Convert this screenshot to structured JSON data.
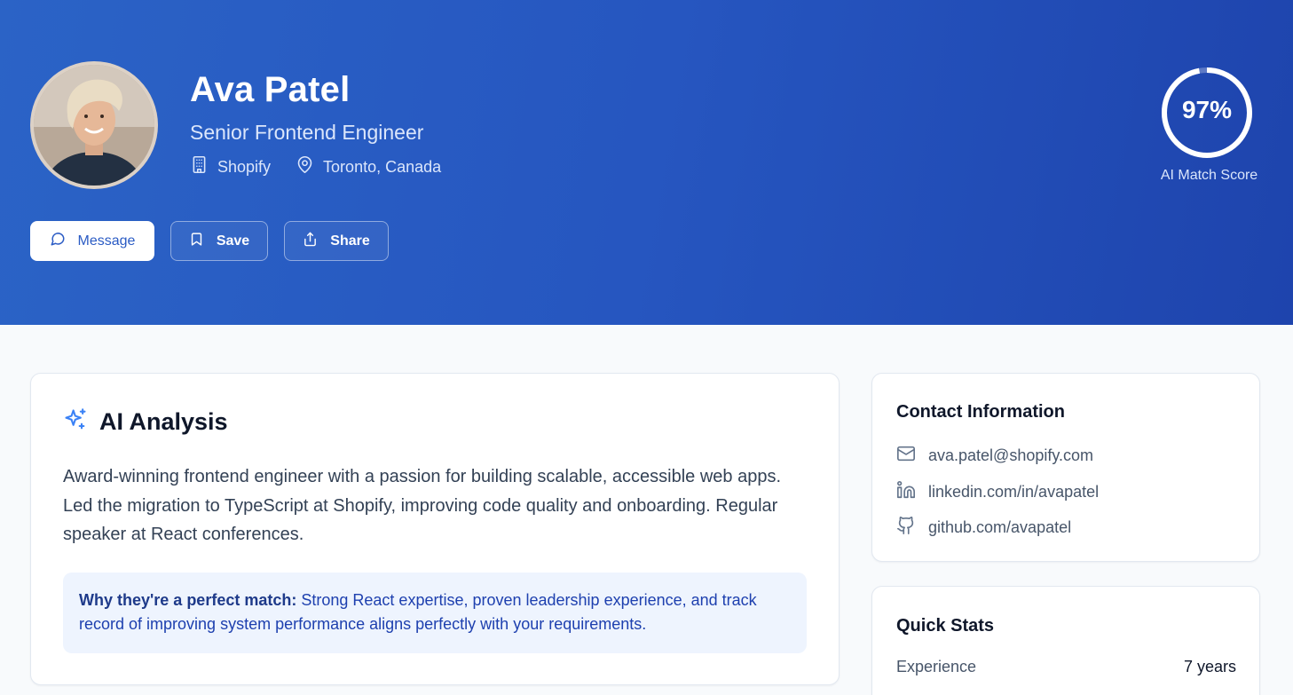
{
  "profile": {
    "name": "Ava Patel",
    "title": "Senior Frontend Engineer",
    "company": "Shopify",
    "location": "Toronto, Canada"
  },
  "actions": {
    "message": "Message",
    "save": "Save",
    "share": "Share"
  },
  "match_score": {
    "value": "97%",
    "fraction": 0.97,
    "label": "AI Match Score"
  },
  "analysis": {
    "title": "AI Analysis",
    "summary": "Award-winning frontend engineer with a passion for building scalable, accessible web apps. Led the migration to TypeScript at Shopify, improving code quality and onboarding. Regular speaker at React conferences.",
    "match_label": "Why they're a perfect match:",
    "match_text": "Strong React expertise, proven leadership experience, and track record of improving system performance aligns perfectly with your requirements."
  },
  "contact": {
    "title": "Contact Information",
    "email": "ava.patel@shopify.com",
    "linkedin": "linkedin.com/in/avapatel",
    "github": "github.com/avapatel"
  },
  "stats": {
    "title": "Quick Stats",
    "items": [
      {
        "label": "Experience",
        "value": "7 years"
      }
    ]
  },
  "icons": {
    "company": "building-icon",
    "location": "map-pin-icon",
    "message": "chat-bubble-icon",
    "save": "bookmark-icon",
    "share": "share-icon",
    "analysis": "sparkles-icon",
    "email": "mail-icon",
    "linkedin": "linkedin-icon",
    "github": "github-icon"
  },
  "colors": {
    "header_start": "#2b63c6",
    "header_end": "#1e44ad",
    "accent": "#2a5bc4",
    "match_bg": "#eef4fe"
  }
}
